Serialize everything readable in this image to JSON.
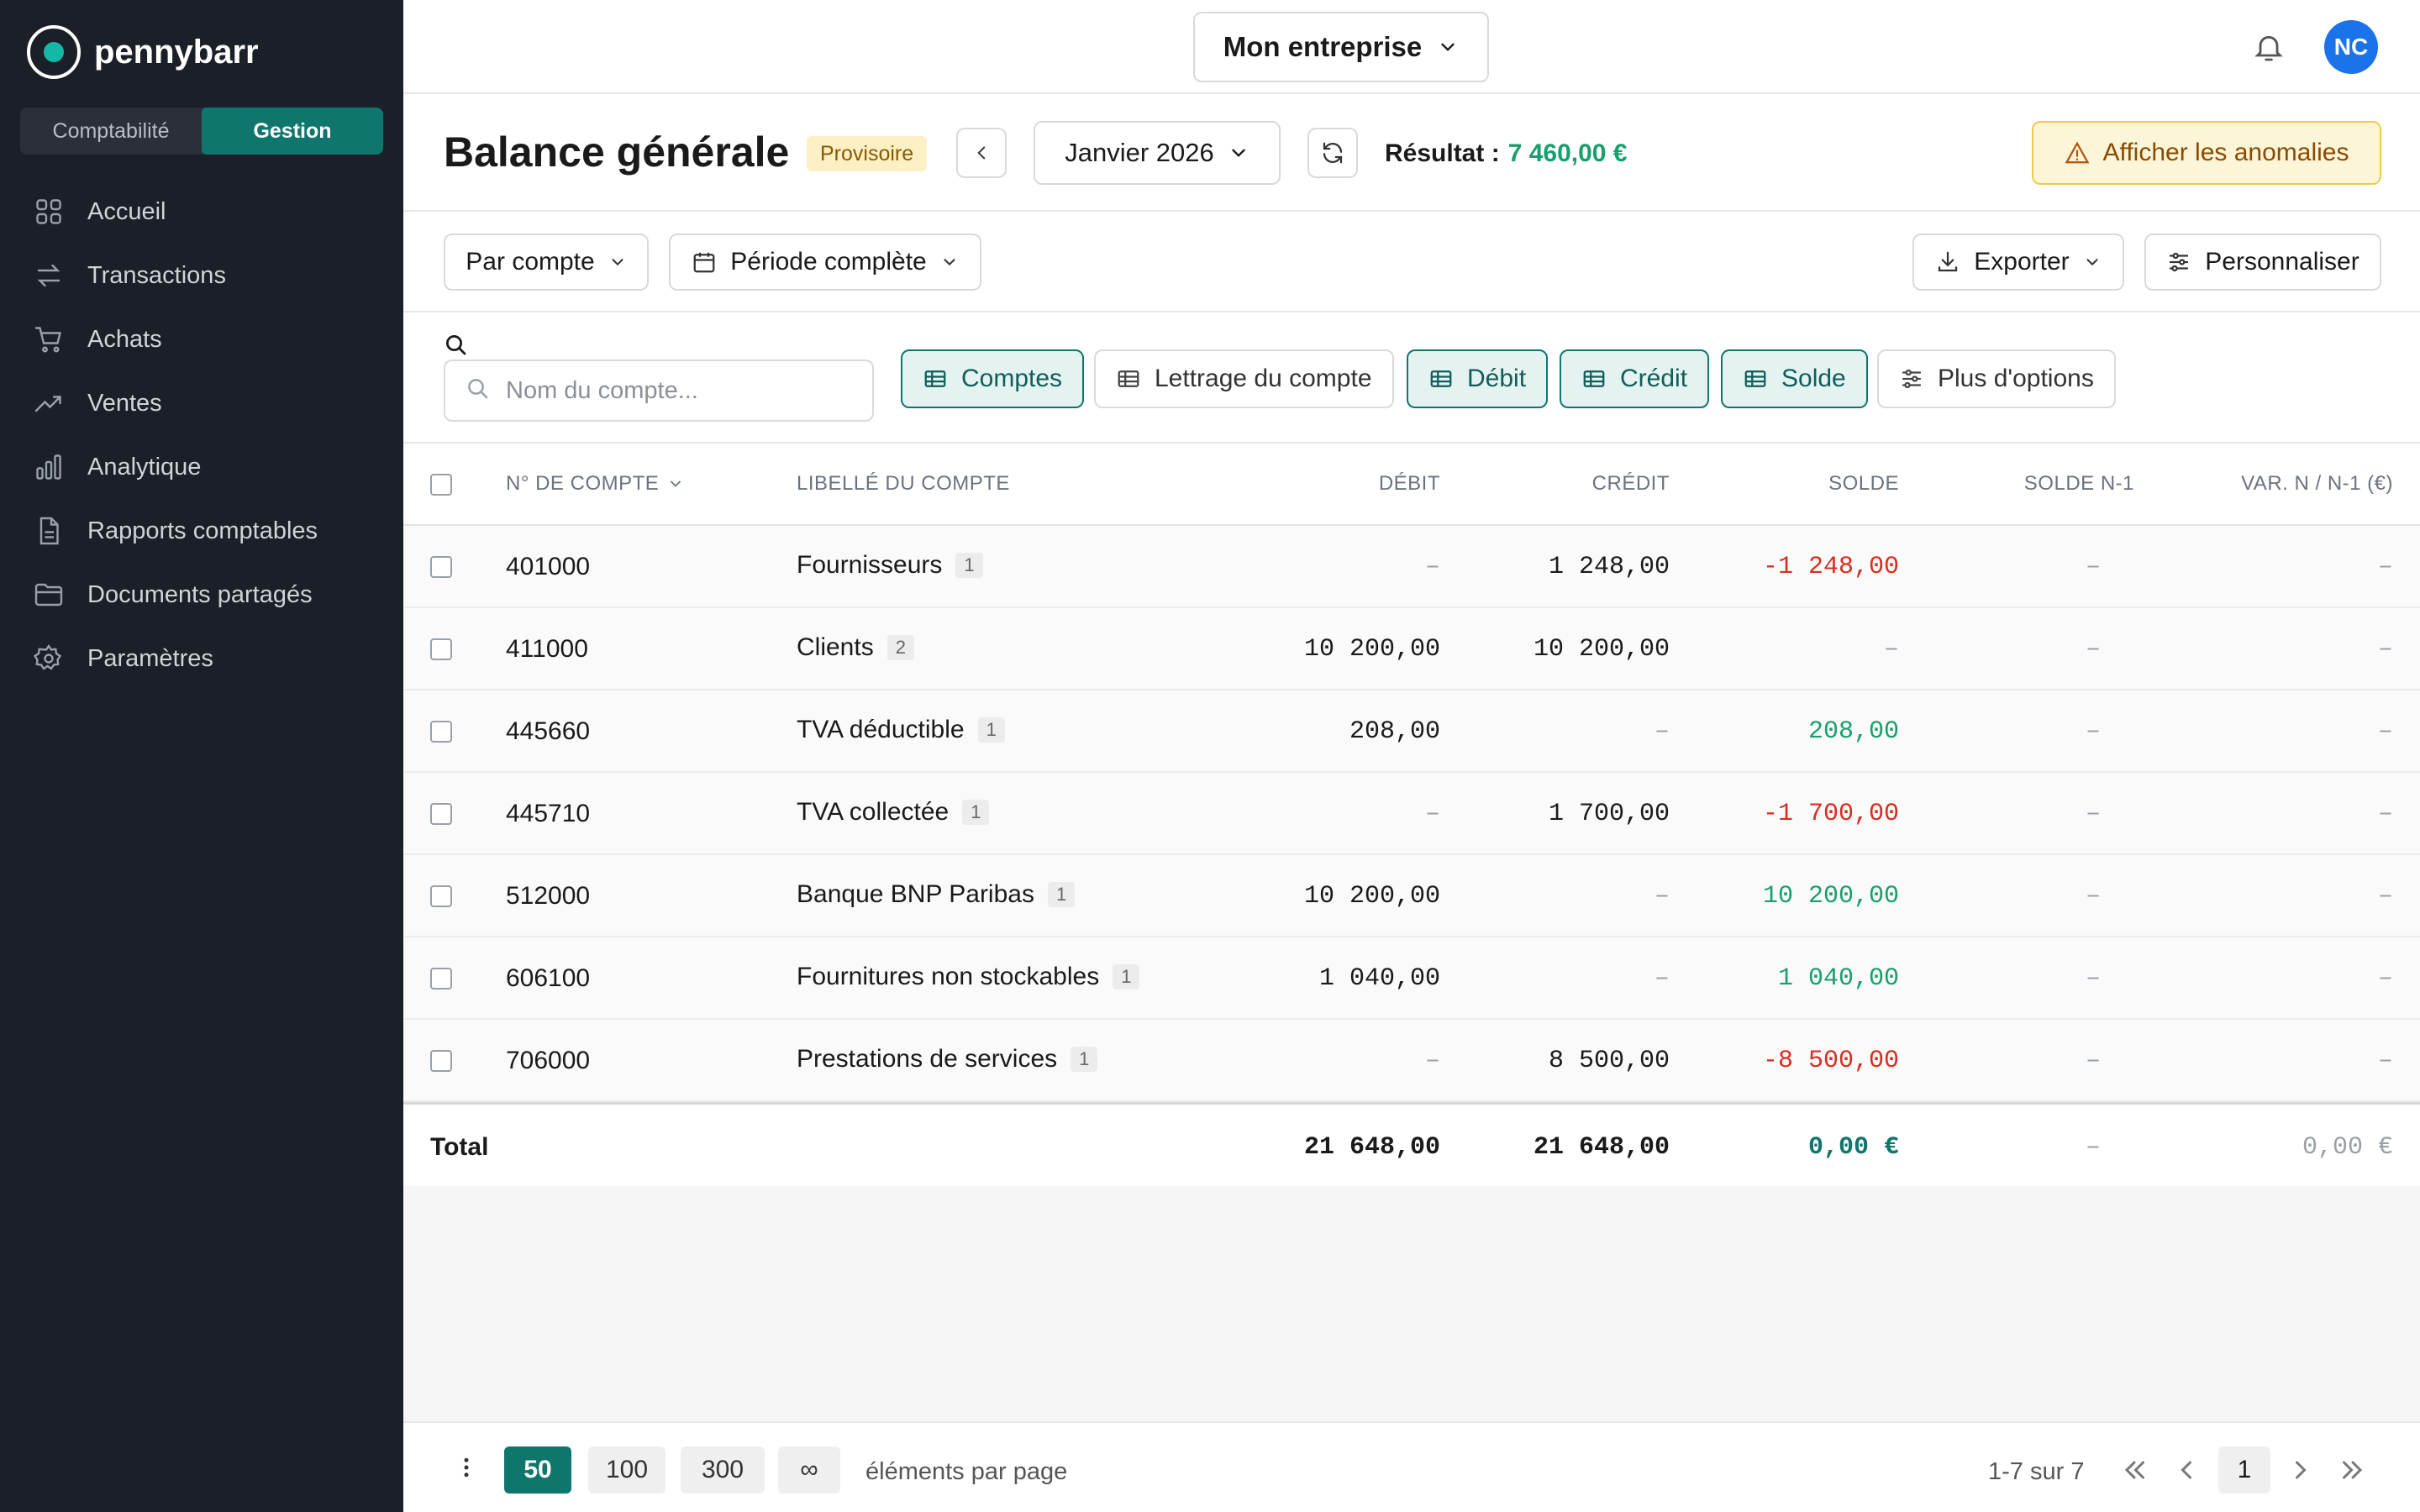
{
  "app": {
    "name": "pennybarr"
  },
  "sidebar": {
    "modes": [
      {
        "label": "Comptabilité",
        "active": false
      },
      {
        "label": "Gestion",
        "active": true
      }
    ],
    "items": [
      {
        "label": "Accueil",
        "icon": "grid-icon"
      },
      {
        "label": "Transactions",
        "icon": "arrows-exchange-icon"
      },
      {
        "label": "Achats",
        "icon": "cart-icon"
      },
      {
        "label": "Ventes",
        "icon": "trending-up-icon"
      },
      {
        "label": "Analytique",
        "icon": "bar-chart-icon"
      },
      {
        "label": "Rapports comptables",
        "icon": "document-icon"
      },
      {
        "label": "Documents partagés",
        "icon": "folder-icon"
      },
      {
        "label": "Paramètres",
        "icon": "gear-icon"
      }
    ]
  },
  "topbar": {
    "company": "Mon entreprise",
    "avatar_initials": "NC",
    "avatar_color": "#1a73e8"
  },
  "header": {
    "title": "Balance générale",
    "status": "Provisoire",
    "month": "Janvier 2026",
    "result_label": "Résultat :",
    "result_value": "7 460,00 €",
    "anomalies_label": "Afficher les anomalies"
  },
  "filters": {
    "group_by": "Par compte",
    "period": "Période complète",
    "export_label": "Exporter",
    "customize_label": "Personnaliser"
  },
  "search": {
    "placeholder": "Nom du compte..."
  },
  "column_toggles": [
    {
      "label": "Comptes",
      "on": true
    },
    {
      "label": "Lettrage du compte",
      "on": false
    },
    {
      "label": "Débit",
      "on": true
    },
    {
      "label": "Crédit",
      "on": true
    },
    {
      "label": "Solde",
      "on": true
    },
    {
      "label": "Plus d'options",
      "on": false
    }
  ],
  "table": {
    "columns": {
      "account_number": "N° DE COMPTE",
      "account_label": "LIBELLÉ DU COMPTE",
      "debit": "DÉBIT",
      "credit": "CRÉDIT",
      "solde": "SOLDE",
      "solde_n1": "SOLDE N-1",
      "variation": "VAR. N / N-1 (€)"
    },
    "rows": [
      {
        "number": "401000",
        "label": "Fournisseurs",
        "count": "1",
        "debit": "–",
        "credit": "1 248,00",
        "solde": "-1 248,00",
        "solde_sign": "neg",
        "solde_n1": "–",
        "variation": "–"
      },
      {
        "number": "411000",
        "label": "Clients",
        "count": "2",
        "debit": "10 200,00",
        "credit": "10 200,00",
        "solde": "–",
        "solde_sign": "none",
        "solde_n1": "–",
        "variation": "–"
      },
      {
        "number": "445660",
        "label": "TVA déductible",
        "count": "1",
        "debit": "208,00",
        "credit": "–",
        "solde": "208,00",
        "solde_sign": "pos",
        "solde_n1": "–",
        "variation": "–"
      },
      {
        "number": "445710",
        "label": "TVA collectée",
        "count": "1",
        "debit": "–",
        "credit": "1 700,00",
        "solde": "-1 700,00",
        "solde_sign": "neg",
        "solde_n1": "–",
        "variation": "–"
      },
      {
        "number": "512000",
        "label": "Banque BNP Paribas",
        "count": "1",
        "debit": "10 200,00",
        "credit": "–",
        "solde": "10 200,00",
        "solde_sign": "pos",
        "solde_n1": "–",
        "variation": "–"
      },
      {
        "number": "606100",
        "label": "Fournitures non stockables",
        "count": "1",
        "debit": "1 040,00",
        "credit": "–",
        "solde": "1 040,00",
        "solde_sign": "pos",
        "solde_n1": "–",
        "variation": "–"
      },
      {
        "number": "706000",
        "label": "Prestations de services",
        "count": "1",
        "debit": "–",
        "credit": "8 500,00",
        "solde": "-8 500,00",
        "solde_sign": "neg",
        "solde_n1": "–",
        "variation": "–"
      }
    ],
    "total": {
      "label": "Total",
      "debit": "21 648,00",
      "credit": "21 648,00",
      "solde": "0,00 €",
      "solde_n1": "–",
      "variation": "0,00 €"
    }
  },
  "footer": {
    "page_sizes": [
      {
        "label": "50",
        "active": true
      },
      {
        "label": "100",
        "active": false
      },
      {
        "label": "300",
        "active": false
      },
      {
        "label": "∞",
        "active": false
      }
    ],
    "per_page_label": "éléments par page",
    "range": "1-7 sur 7",
    "current_page": "1"
  },
  "colors": {
    "accent": "#0f766e",
    "negative": "#d92d20",
    "positive": "#16a06c",
    "sidebar_bg": "#1b1f27"
  }
}
